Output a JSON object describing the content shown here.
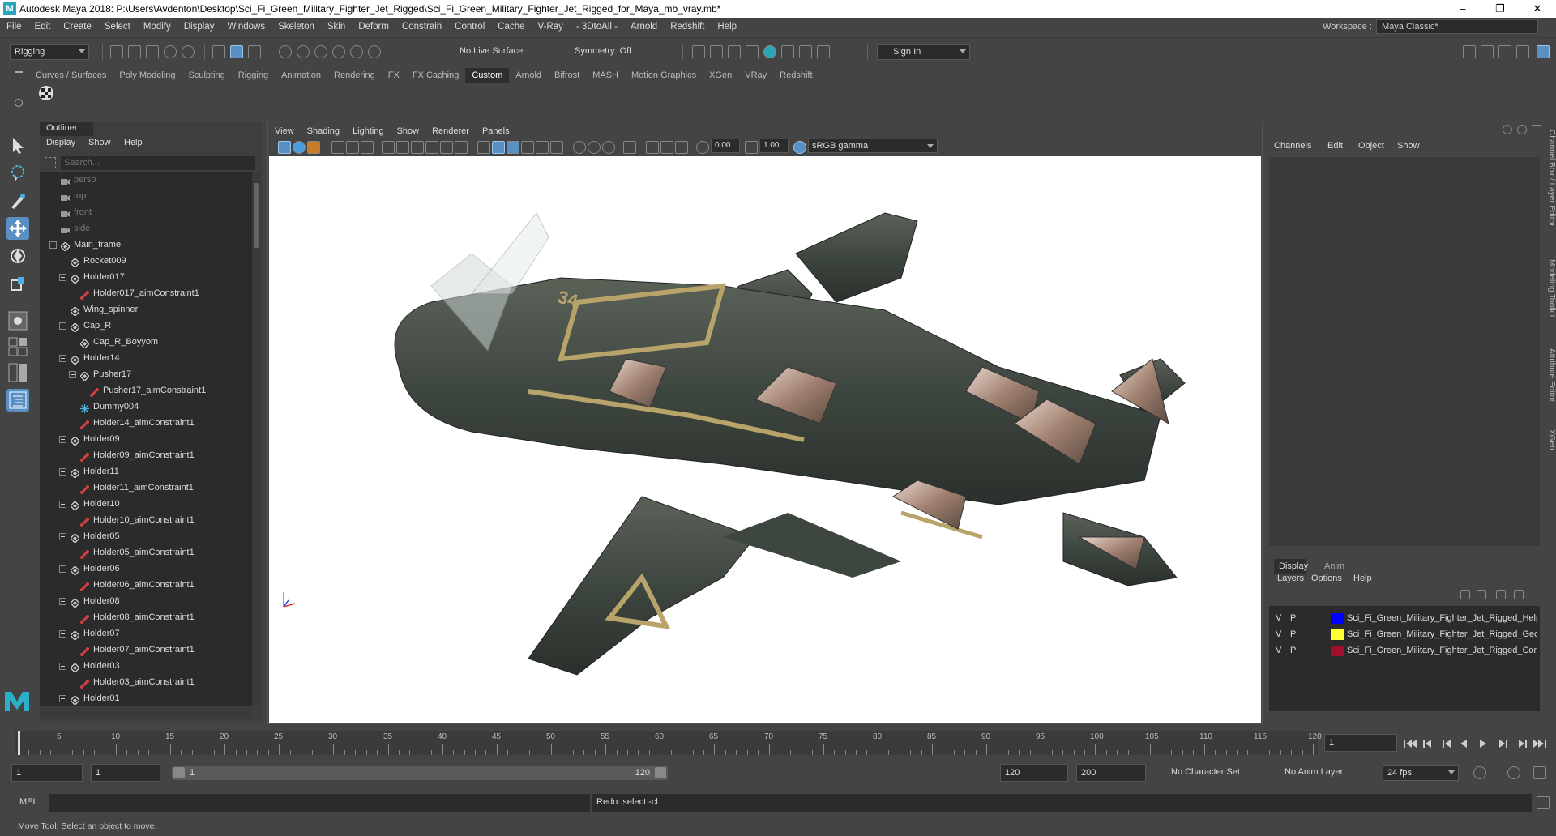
{
  "window": {
    "title": "Autodesk Maya 2018: P:\\Users\\Avdenton\\Desktop\\Sci_Fi_Green_Military_Fighter_Jet_Rigged\\Sci_Fi_Green_Military_Fighter_Jet_Rigged_for_Maya_mb_vray.mb*",
    "minimize": "–",
    "maximize": "❐",
    "close": "✕"
  },
  "menubar": [
    "File",
    "Edit",
    "Create",
    "Select",
    "Modify",
    "Display",
    "Windows",
    "Skeleton",
    "Skin",
    "Deform",
    "Constrain",
    "Control",
    "Cache",
    "V-Ray",
    "- 3DtoAll -",
    "Arnold",
    "Redshift",
    "Help"
  ],
  "workspace": {
    "label": "Workspace :",
    "value": "Maya Classic*"
  },
  "statusline": {
    "mode": "Rigging",
    "live_surface": "No Live Surface",
    "symmetry": "Symmetry: Off",
    "sign_in": "Sign In"
  },
  "shelf_tabs": [
    "Curves / Surfaces",
    "Poly Modeling",
    "Sculpting",
    "Rigging",
    "Animation",
    "Rendering",
    "FX",
    "FX Caching",
    "Custom",
    "Arnold",
    "Bifrost",
    "MASH",
    "Motion Graphics",
    "XGen",
    "VRay",
    "Redshift"
  ],
  "shelf_selected": "Custom",
  "outliner": {
    "tab": "Outliner",
    "menu": [
      "Display",
      "Show",
      "Help"
    ],
    "search_placeholder": "Search...",
    "rows": [
      {
        "label": "persp",
        "level": 0,
        "icon": "camera",
        "dim": true,
        "expand": false
      },
      {
        "label": "top",
        "level": 0,
        "icon": "camera",
        "dim": true,
        "expand": false
      },
      {
        "label": "front",
        "level": 0,
        "icon": "camera",
        "dim": true,
        "expand": false
      },
      {
        "label": "side",
        "level": 0,
        "icon": "camera",
        "dim": true,
        "expand": false
      },
      {
        "label": "Main_frame",
        "level": 0,
        "icon": "transform",
        "dim": false,
        "expand": true
      },
      {
        "label": "Rocket009",
        "level": 1,
        "icon": "transform",
        "dim": false,
        "expand": false
      },
      {
        "label": "Holder017",
        "level": 1,
        "icon": "transform",
        "dim": false,
        "expand": true
      },
      {
        "label": "Holder017_aimConstraint1",
        "level": 2,
        "icon": "constraint",
        "dim": false,
        "expand": false
      },
      {
        "label": "Wing_spinner",
        "level": 1,
        "icon": "transform",
        "dim": false,
        "expand": false
      },
      {
        "label": "Cap_R",
        "level": 1,
        "icon": "transform",
        "dim": false,
        "expand": true
      },
      {
        "label": "Cap_R_Boyyom",
        "level": 2,
        "icon": "transform",
        "dim": false,
        "expand": false
      },
      {
        "label": "Holder14",
        "level": 1,
        "icon": "transform",
        "dim": false,
        "expand": true
      },
      {
        "label": "Pusher17",
        "level": 2,
        "icon": "transform",
        "dim": false,
        "expand": true
      },
      {
        "label": "Pusher17_aimConstraint1",
        "level": 3,
        "icon": "constraint",
        "dim": false,
        "expand": false
      },
      {
        "label": "Dummy004",
        "level": 2,
        "icon": "locator",
        "dim": false,
        "expand": false
      },
      {
        "label": "Holder14_aimConstraint1",
        "level": 2,
        "icon": "constraint",
        "dim": false,
        "expand": false
      },
      {
        "label": "Holder09",
        "level": 1,
        "icon": "transform",
        "dim": false,
        "expand": true
      },
      {
        "label": "Holder09_aimConstraint1",
        "level": 2,
        "icon": "constraint",
        "dim": false,
        "expand": false
      },
      {
        "label": "Holder11",
        "level": 1,
        "icon": "transform",
        "dim": false,
        "expand": true
      },
      {
        "label": "Holder11_aimConstraint1",
        "level": 2,
        "icon": "constraint",
        "dim": false,
        "expand": false
      },
      {
        "label": "Holder10",
        "level": 1,
        "icon": "transform",
        "dim": false,
        "expand": true
      },
      {
        "label": "Holder10_aimConstraint1",
        "level": 2,
        "icon": "constraint",
        "dim": false,
        "expand": false
      },
      {
        "label": "Holder05",
        "level": 1,
        "icon": "transform",
        "dim": false,
        "expand": true
      },
      {
        "label": "Holder05_aimConstraint1",
        "level": 2,
        "icon": "constraint",
        "dim": false,
        "expand": false
      },
      {
        "label": "Holder06",
        "level": 1,
        "icon": "transform",
        "dim": false,
        "expand": true
      },
      {
        "label": "Holder06_aimConstraint1",
        "level": 2,
        "icon": "constraint",
        "dim": false,
        "expand": false
      },
      {
        "label": "Holder08",
        "level": 1,
        "icon": "transform",
        "dim": false,
        "expand": true
      },
      {
        "label": "Holder08_aimConstraint1",
        "level": 2,
        "icon": "constraint",
        "dim": false,
        "expand": false
      },
      {
        "label": "Holder07",
        "level": 1,
        "icon": "transform",
        "dim": false,
        "expand": true
      },
      {
        "label": "Holder07_aimConstraint1",
        "level": 2,
        "icon": "constraint",
        "dim": false,
        "expand": false
      },
      {
        "label": "Holder03",
        "level": 1,
        "icon": "transform",
        "dim": false,
        "expand": true
      },
      {
        "label": "Holder03_aimConstraint1",
        "level": 2,
        "icon": "constraint",
        "dim": false,
        "expand": false
      },
      {
        "label": "Holder01",
        "level": 1,
        "icon": "transform",
        "dim": false,
        "expand": true
      }
    ]
  },
  "viewport": {
    "menu": [
      "View",
      "Shading",
      "Lighting",
      "Show",
      "Renderer",
      "Panels"
    ],
    "exposure": "0.00",
    "gamma": "1.00",
    "colorspace": "sRGB gamma",
    "jet_number": "34"
  },
  "channelbox": {
    "menu": [
      "Channels",
      "Edit",
      "Object",
      "Show"
    ],
    "tabs": [
      "Display",
      "Anim"
    ],
    "layer_menu": [
      "Layers",
      "Options",
      "Help"
    ],
    "layers": [
      {
        "v": "V",
        "p": "P",
        "color": "#0000ff",
        "name": "Sci_Fi_Green_Military_Fighter_Jet_Rigged_Helpers"
      },
      {
        "v": "V",
        "p": "P",
        "color": "#ffff33",
        "name": "Sci_Fi_Green_Military_Fighter_Jet_Rigged_Geometry"
      },
      {
        "v": "V",
        "p": "P",
        "color": "#a0102a",
        "name": "Sci_Fi_Green_Military_Fighter_Jet_Rigged_Controllers"
      }
    ]
  },
  "side_tabs": [
    "Channel Box / Layer Editor",
    "Modeling Toolkit",
    "Attribute Editor",
    "XGen"
  ],
  "timeline": {
    "ticks": [
      "5",
      "10",
      "15",
      "20",
      "25",
      "30",
      "35",
      "40",
      "45",
      "50",
      "55",
      "60",
      "65",
      "70",
      "75",
      "80",
      "85",
      "90",
      "95",
      "100",
      "105",
      "110",
      "115",
      "120"
    ],
    "current_frame": "1"
  },
  "range": {
    "start": "1",
    "playback_start": "1",
    "slider_start": "1",
    "slider_end": "120",
    "playback_end": "120",
    "end": "200",
    "character_set": "No Character Set",
    "anim_layer": "No Anim Layer",
    "fps": "24 fps"
  },
  "cmdline": {
    "lang": "MEL",
    "result": "Redo: select -cl"
  },
  "helpline": "Move Tool: Select an object to move."
}
